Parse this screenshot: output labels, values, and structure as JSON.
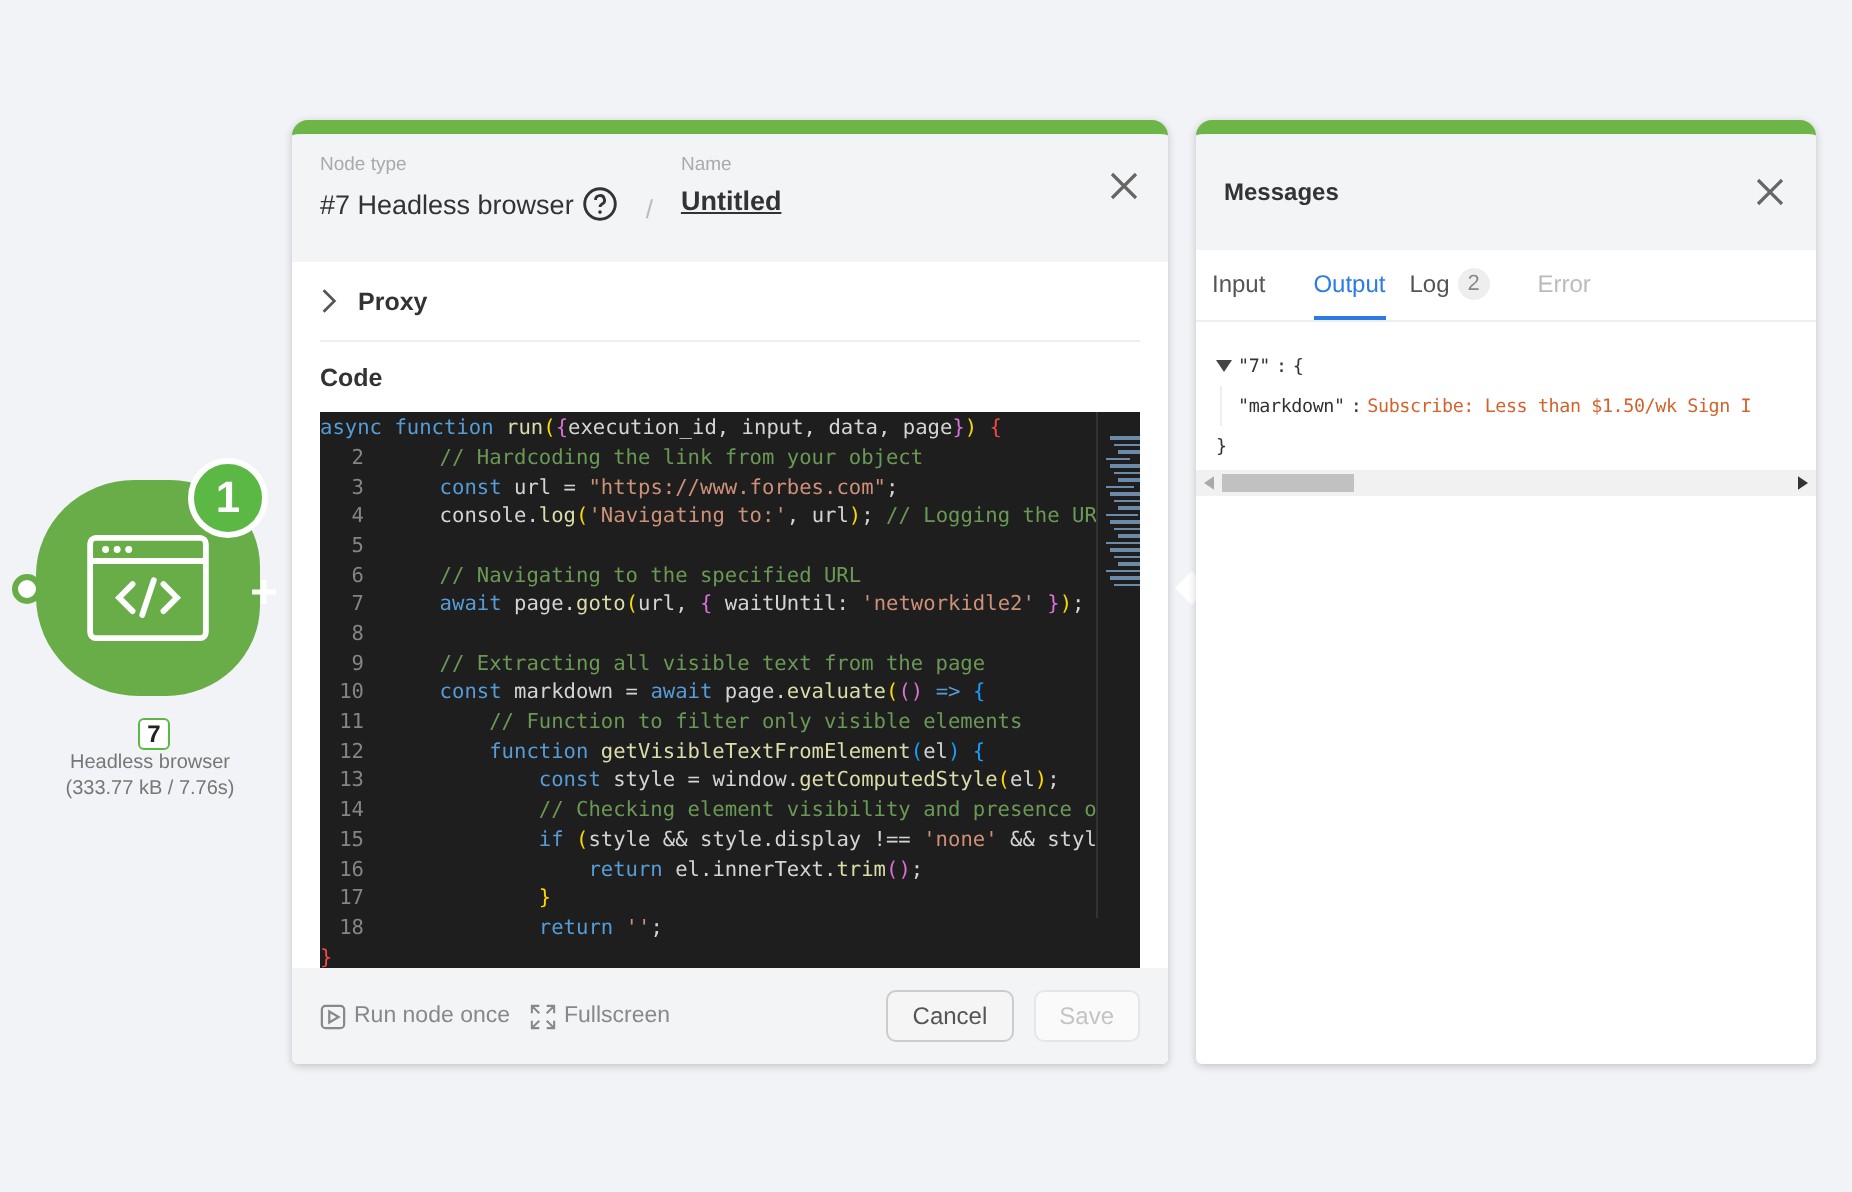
{
  "node": {
    "badge": "1",
    "number": "7",
    "name": "Headless browser",
    "stats": "(333.77 kB / 7.76s)"
  },
  "editor": {
    "node_type_label": "Node type",
    "node_type": "#7 Headless browser",
    "separator": "/",
    "name_label": "Name",
    "name": "Untitled",
    "sections": [
      {
        "label": "Proxy",
        "expanded": false
      }
    ],
    "code_label": "Code",
    "code_lines": [
      {
        "tokens": [
          {
            "t": "async function ",
            "kind": "keyword"
          },
          {
            "t": "run",
            "kind": "function"
          },
          {
            "t": "(",
            "kind": "bracket"
          },
          {
            "t": "{",
            "kind": "bracket2"
          },
          {
            "t": "execution_id, input, data, page",
            "kind": "plain"
          },
          {
            "t": "}",
            "kind": "bracket2"
          },
          {
            "t": ")",
            "kind": "bracket"
          },
          {
            "t": " {",
            "kind": "error"
          }
        ]
      },
      {
        "number": "2",
        "tokens": [
          {
            "t": "    // Hardcoding the link from your object",
            "kind": "comment"
          }
        ]
      },
      {
        "number": "3",
        "tokens": [
          {
            "t": "    const ",
            "kind": "keyword"
          },
          {
            "t": "url = ",
            "kind": "plain"
          },
          {
            "t": "\"https://www.forbes.com\"",
            "kind": "string"
          },
          {
            "t": ";",
            "kind": "plain"
          }
        ]
      },
      {
        "number": "4",
        "tokens": [
          {
            "t": "    console.",
            "kind": "plain"
          },
          {
            "t": "log",
            "kind": "function"
          },
          {
            "t": "(",
            "kind": "bracket"
          },
          {
            "t": "'Navigating to:'",
            "kind": "string"
          },
          {
            "t": ", url",
            "kind": "plain"
          },
          {
            "t": ")",
            "kind": "bracket"
          },
          {
            "t": "; ",
            "kind": "plain"
          },
          {
            "t": "// Logging the UR",
            "kind": "comment"
          }
        ]
      },
      {
        "number": "5"
      },
      {
        "number": "6",
        "tokens": [
          {
            "t": "    // Navigating to the specified URL",
            "kind": "comment"
          }
        ]
      },
      {
        "number": "7",
        "tokens": [
          {
            "t": "    await ",
            "kind": "keyword"
          },
          {
            "t": "page.",
            "kind": "plain"
          },
          {
            "t": "goto",
            "kind": "function"
          },
          {
            "t": "(",
            "kind": "bracket"
          },
          {
            "t": "url, ",
            "kind": "plain"
          },
          {
            "t": "{",
            "kind": "bracket2"
          },
          {
            "t": " waitUntil: ",
            "kind": "plain"
          },
          {
            "t": "'networkidle2'",
            "kind": "string"
          },
          {
            "t": " }",
            "kind": "bracket2"
          },
          {
            "t": ")",
            "kind": "bracket"
          },
          {
            "t": ";",
            "kind": "plain"
          }
        ]
      },
      {
        "number": "8"
      },
      {
        "number": "9",
        "tokens": [
          {
            "t": "    // Extracting all visible text from the page",
            "kind": "comment"
          }
        ]
      },
      {
        "number": "10",
        "tokens": [
          {
            "t": "    const ",
            "kind": "keyword"
          },
          {
            "t": "markdown = ",
            "kind": "plain"
          },
          {
            "t": "await ",
            "kind": "keyword"
          },
          {
            "t": "page.",
            "kind": "plain"
          },
          {
            "t": "evaluate",
            "kind": "function"
          },
          {
            "t": "(",
            "kind": "bracket"
          },
          {
            "t": "()",
            "kind": "bracket2"
          },
          {
            "t": " => ",
            "kind": "keyword"
          },
          {
            "t": "{",
            "kind": "bracket3"
          }
        ]
      },
      {
        "number": "11",
        "tokens": [
          {
            "t": "        // Function to filter only visible elements",
            "kind": "comment"
          }
        ]
      },
      {
        "number": "12",
        "tokens": [
          {
            "t": "        function ",
            "kind": "keyword"
          },
          {
            "t": "getVisibleTextFromElement",
            "kind": "function"
          },
          {
            "t": "(",
            "kind": "bracket3"
          },
          {
            "t": "el",
            "kind": "plain"
          },
          {
            "t": ")",
            "kind": "bracket3"
          },
          {
            "t": " {",
            "kind": "bracket3"
          }
        ]
      },
      {
        "number": "13",
        "tokens": [
          {
            "t": "            const ",
            "kind": "keyword"
          },
          {
            "t": "style = window.",
            "kind": "plain"
          },
          {
            "t": "getComputedStyle",
            "kind": "function"
          },
          {
            "t": "(",
            "kind": "bracket"
          },
          {
            "t": "el",
            "kind": "plain"
          },
          {
            "t": ")",
            "kind": "bracket"
          },
          {
            "t": ";",
            "kind": "plain"
          }
        ]
      },
      {
        "number": "14",
        "tokens": [
          {
            "t": "            // Checking element visibility and presence o",
            "kind": "comment"
          }
        ]
      },
      {
        "number": "15",
        "tokens": [
          {
            "t": "            if ",
            "kind": "keyword"
          },
          {
            "t": "(",
            "kind": "bracket"
          },
          {
            "t": "style && style.display !== ",
            "kind": "plain"
          },
          {
            "t": "'none'",
            "kind": "string"
          },
          {
            "t": " && styl",
            "kind": "plain"
          }
        ]
      },
      {
        "number": "16",
        "tokens": [
          {
            "t": "                return ",
            "kind": "keyword"
          },
          {
            "t": "el.innerText.",
            "kind": "plain"
          },
          {
            "t": "trim",
            "kind": "function"
          },
          {
            "t": "()",
            "kind": "bracket2"
          },
          {
            "t": ";",
            "kind": "plain"
          }
        ]
      },
      {
        "number": "17",
        "tokens": [
          {
            "t": "            }",
            "kind": "bracket"
          }
        ]
      },
      {
        "number": "18",
        "tokens": [
          {
            "t": "            return ",
            "kind": "keyword"
          },
          {
            "t": "''",
            "kind": "string"
          },
          {
            "t": ";",
            "kind": "plain"
          }
        ]
      },
      {
        "tokens": [
          {
            "t": "}",
            "kind": "error"
          }
        ]
      }
    ],
    "footer_actions": [
      {
        "label": "Run node once",
        "kind": "run"
      },
      {
        "label": "Fullscreen",
        "kind": "fullscreen"
      }
    ],
    "buttons": [
      {
        "label": "Cancel",
        "disabled": false
      },
      {
        "label": "Save",
        "disabled": true
      }
    ]
  },
  "messages": {
    "title": "Messages",
    "tabs": [
      {
        "label": "Input",
        "selected": false,
        "disabled": false
      },
      {
        "label": "Output",
        "selected": true,
        "disabled": false
      },
      {
        "label": "Log",
        "count": "2",
        "selected": false,
        "disabled": false
      },
      {
        "label": "Error",
        "selected": false,
        "disabled": true
      }
    ],
    "tree": {
      "key": "\"7\"",
      "colon": ":",
      "expanded": true,
      "open": "{",
      "close": "}",
      "entries": [
        {
          "key": "\"markdown\"",
          "colon": ":",
          "value": "Subscribe: Less than $1.50/wk Sign I"
        }
      ]
    }
  }
}
